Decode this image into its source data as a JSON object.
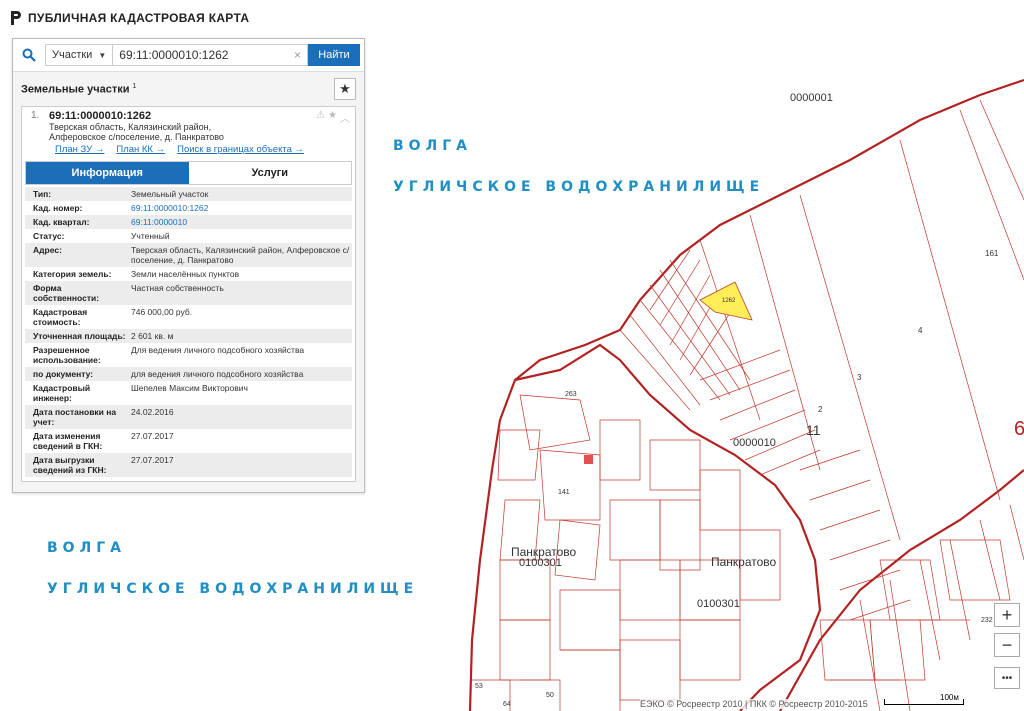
{
  "app": {
    "title": "ПУБЛИЧНАЯ КАДАСТРОВАЯ КАРТА"
  },
  "search": {
    "type_label": "Участки",
    "query": "69:11:0000010:1262",
    "button": "Найти"
  },
  "results": {
    "heading": "Земельные участки",
    "count": "1",
    "item": {
      "index": "1.",
      "cad_number": "69:11:0000010:1262",
      "address_line1": "Тверская область, Калязинский район,",
      "address_line2": "Алферовское с/поселение, д. Панкратово",
      "links": [
        "План ЗУ →",
        "План КК →",
        "Поиск в границах объекта →"
      ]
    },
    "tabs": [
      "Информация",
      "Услуги"
    ],
    "rows": [
      {
        "k": "Тип:",
        "v": "Земельный участок"
      },
      {
        "k": "Кад. номер:",
        "v": "69:11:0000010:1262"
      },
      {
        "k": "Кад. квартал:",
        "v": "69:11:0000010"
      },
      {
        "k": "Статус:",
        "v": "Учтенный"
      },
      {
        "k": "Адрес:",
        "v": "Тверская область, Калязинский район, Алферовское с/поселение, д. Панкратово"
      },
      {
        "k": "Категория земель:",
        "v": "Земли населённых пунктов"
      },
      {
        "k": "Форма собственности:",
        "v": "Частная собственность"
      },
      {
        "k": "Кадастровая стоимость:",
        "v": "746 000,00 руб."
      },
      {
        "k": "Уточненная площадь:",
        "v": "2 601 кв. м"
      },
      {
        "k": "Разрешенное использование:",
        "v": "Для ведения личного подсобного хозяйства"
      },
      {
        "k": "по документу:",
        "v": "для ведения личного подсобного хозяйства"
      },
      {
        "k": "Кадастровый инженер:",
        "v": "Шепелев Максим Викторович"
      },
      {
        "k": "Дата постановки на учет:",
        "v": "24.02.2016"
      },
      {
        "k": "Дата изменения сведений в ГКН:",
        "v": "27.07.2017"
      },
      {
        "k": "Дата выгрузки сведений из ГКН:",
        "v": "27.07.2017"
      }
    ]
  },
  "map": {
    "water_label_1": "ВОЛГА",
    "water_label_2": "УГЛИЧСКОЕ ВОДОХРАНИЛИЩЕ",
    "labels": {
      "q0000001": "0000001",
      "n161": "161",
      "n4": "4",
      "n3": "3",
      "n2": "2",
      "n11": "11",
      "n6": "6",
      "q0000010": "0000010",
      "pankr1": "Панкратово",
      "pankr2": "Панкратово",
      "q0100301a": "0100301",
      "q0100301b": "0100301",
      "n263": "263",
      "n141": "141",
      "n1262": "1262",
      "n232": "232",
      "n50": "50",
      "n53": "53",
      "n64": "64"
    },
    "zoom_in": "+",
    "zoom_out": "−",
    "more": "•••",
    "attribution": "ЕЭКО © Росреестр 2010 | ПКК © Росреестр 2010-2015",
    "scale": "100м",
    "colors": {
      "boundary": "#b22222",
      "parcel": "#c0392b",
      "selected": "#ffee58",
      "water_text": "#1f8fc4",
      "accent": "#1a6fb8"
    }
  }
}
